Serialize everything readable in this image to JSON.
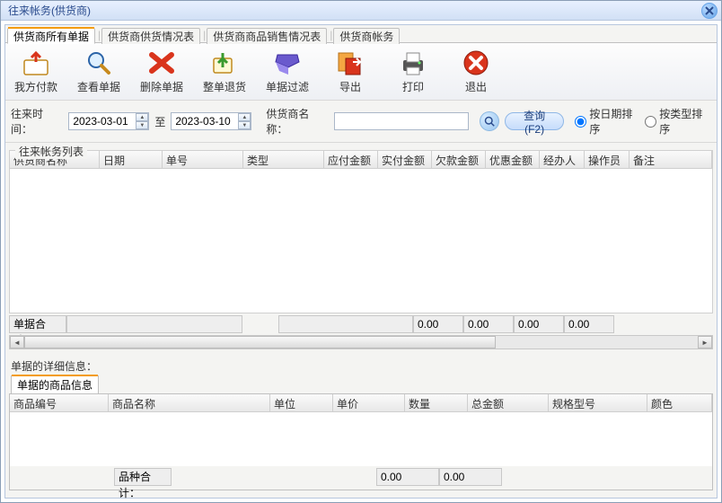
{
  "window": {
    "title": "往来帐务(供货商)"
  },
  "tabs": [
    "供货商所有单据",
    "供货商供货情况表",
    "供货商商品销售情况表",
    "供货商帐务"
  ],
  "toolbar": [
    {
      "key": "pay",
      "label": "我方付款"
    },
    {
      "key": "view",
      "label": "查看单据"
    },
    {
      "key": "delete",
      "label": "删除单据"
    },
    {
      "key": "return",
      "label": "整单退货"
    },
    {
      "key": "filter",
      "label": "单据过滤"
    },
    {
      "key": "export",
      "label": "导出"
    },
    {
      "key": "print",
      "label": "打印"
    },
    {
      "key": "exit",
      "label": "退出"
    }
  ],
  "filter": {
    "date_label": "往来时间：",
    "date_from": "2023-03-01",
    "to": "至",
    "date_to": "2023-03-10",
    "name_label": "供货商名称：",
    "name_value": "",
    "query_btn": "查询(F2)",
    "sort_date": "按日期排序",
    "sort_type": "按类型排序"
  },
  "list_caption": "往来帐务列表",
  "cols_a": [
    "供货商名称",
    "日期",
    "单号",
    "类型",
    "应付金额",
    "实付金额",
    "欠款金额",
    "优惠金额",
    "经办人",
    "操作员",
    "备注"
  ],
  "sum_a": {
    "label": "单据合计：",
    "v1": "0.00",
    "v2": "0.00",
    "v3": "0.00",
    "v4": "0.00"
  },
  "detail_label": "单据的详细信息：",
  "subtab": "单据的商品信息",
  "cols_b": [
    "商品编号",
    "商品名称",
    "单位",
    "单价",
    "数量",
    "总金额",
    "规格型号",
    "颜色"
  ],
  "sum_b": {
    "label": "品种合计：",
    "v1": "0.00",
    "v2": "0.00"
  }
}
